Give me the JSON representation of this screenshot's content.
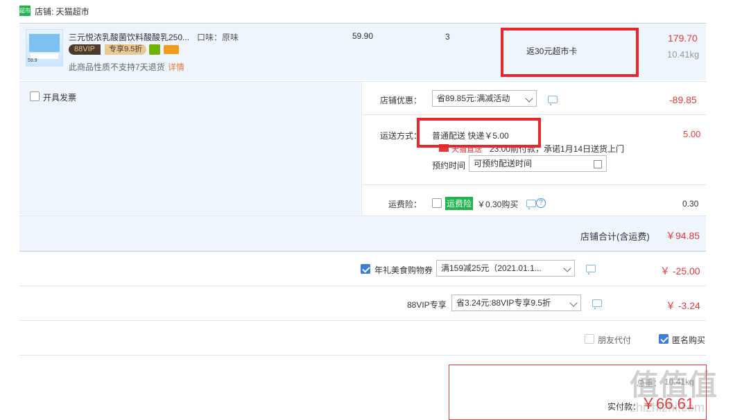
{
  "store": {
    "label": "店铺: 天猫超市",
    "logo_text": "超市"
  },
  "product": {
    "name": "三元悦浓乳酸菌饮料酸酸乳250...",
    "flavor": "口味：原味",
    "vip_tag": "88VIP",
    "vip_discount": "专享9.5折",
    "return_note": "此商品性质不支持7天退货",
    "detail_link": "详情",
    "price": "59.90",
    "quantity": "3",
    "promo": "返30元超市卡",
    "subtotal": "179.70",
    "weight": "10.41kg",
    "thumb_price": "59.9"
  },
  "invoice": {
    "label": "开具发票"
  },
  "store_discount": {
    "label": "店铺优惠：",
    "selected": "省89.85元:满减活动",
    "amount": "-89.85"
  },
  "shipping": {
    "label": "运送方式：",
    "selected": "普通配送 快递￥5.00",
    "badge": "天猫直送",
    "promise": "23:00前付款，承诺1月14日送货上门",
    "schedule_label": "预约时间",
    "schedule_value": "可预约配送时间",
    "amount": "5.00"
  },
  "insurance": {
    "label": "运费险：",
    "badge": "运费险",
    "price": "￥0.30购买",
    "amount": "0.30"
  },
  "store_total": {
    "label": "店铺合计(含运费)",
    "amount": "￥94.85"
  },
  "coupon": {
    "label": "年礼美食购物券",
    "selected": "满159减25元（2021.01.1...",
    "amount": "￥ -25.00"
  },
  "vip": {
    "label": "88VIP专享",
    "selected": "省3.24元:88VIP专享9.5折",
    "amount": "￥ -3.24"
  },
  "options": {
    "friend_pay": "朋友代付",
    "anonymous": "匿名购买"
  },
  "summary": {
    "weight_label": "总重：",
    "weight_value": "10.41kg",
    "pay_label": "实付款：",
    "pay_amount": "￥66.61"
  },
  "watermark": {
    "text": "值值值",
    "sub": "zhizhizhi.com"
  },
  "colors": {
    "accent_red": "#e4393c",
    "highlight_box": "#e8262b",
    "row_bg": "#eef5fd",
    "tmall_green": "#1fb54d"
  }
}
